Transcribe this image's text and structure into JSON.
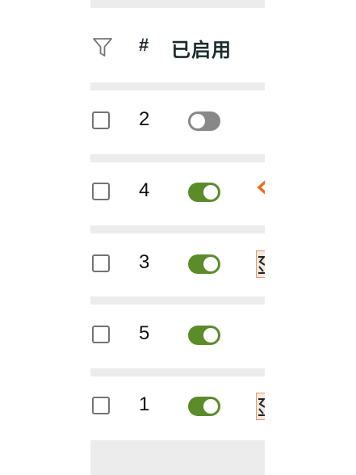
{
  "header": {
    "filter_icon": "filter-icon",
    "number_label": "#",
    "enabled_label": "已启用"
  },
  "rows": [
    {
      "number": "2",
      "enabled": false,
      "extra": "none"
    },
    {
      "number": "4",
      "enabled": true,
      "extra": "chevron"
    },
    {
      "number": "3",
      "enabled": true,
      "extra": "thumbnail"
    },
    {
      "number": "5",
      "enabled": true,
      "extra": "none"
    },
    {
      "number": "1",
      "enabled": true,
      "extra": "thumbnail"
    }
  ],
  "colors": {
    "toggle_on": "#5c8c2a",
    "toggle_off": "#888888",
    "separator": "#ececec",
    "accent_orange": "#f06a1f"
  }
}
